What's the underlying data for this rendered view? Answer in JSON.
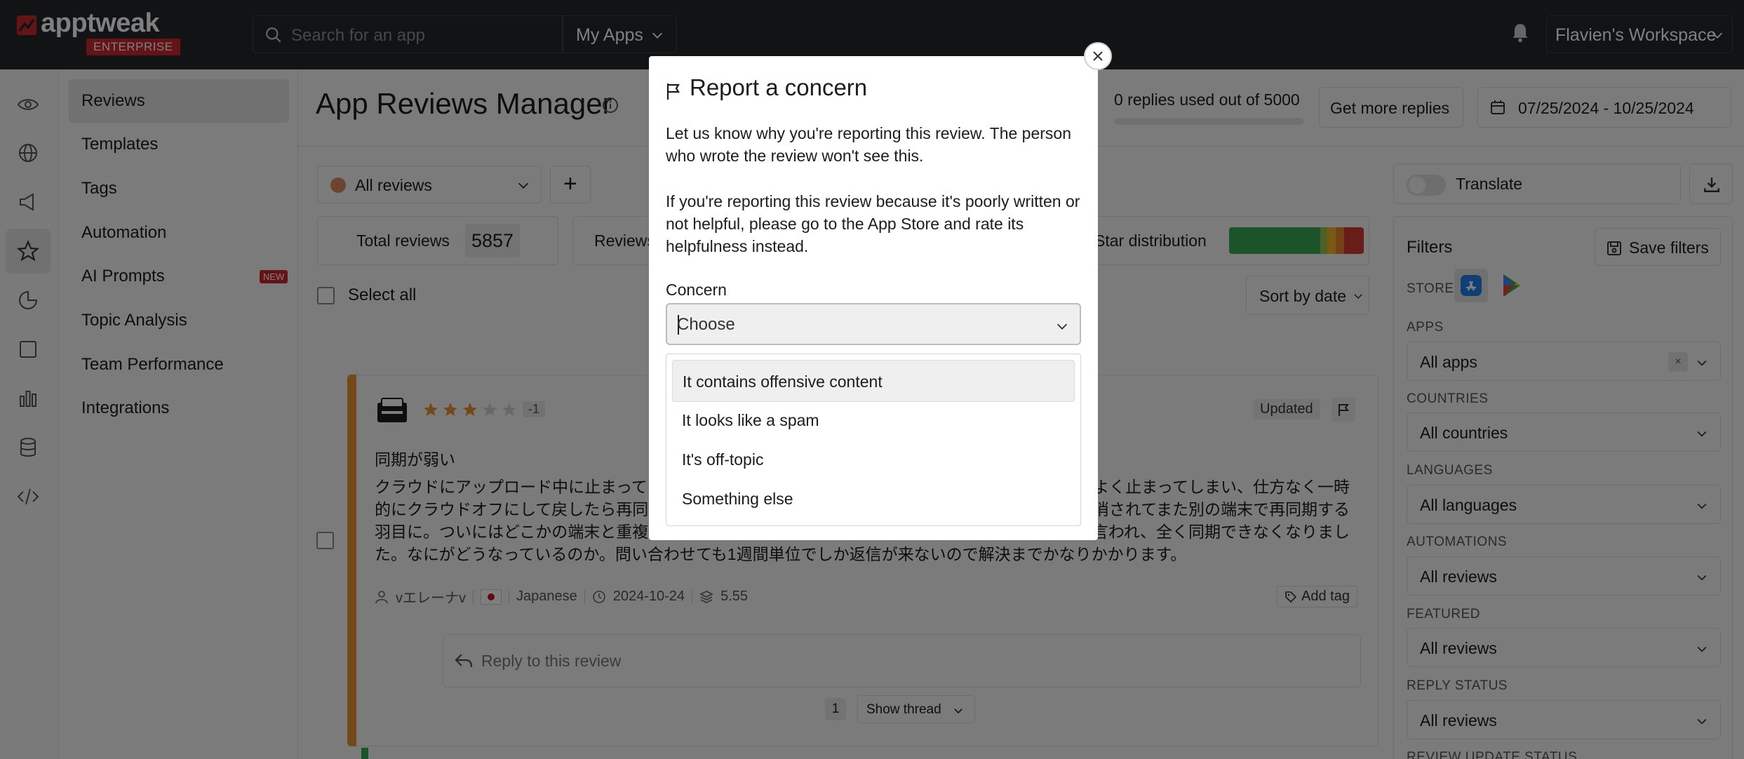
{
  "brand": {
    "name": "apptweak",
    "badge": "ENTERPRISE"
  },
  "topbar": {
    "search_placeholder": "Search for an app",
    "my_apps": "My Apps",
    "workspace": "Flavien's Workspace"
  },
  "sidebar": {
    "items": [
      {
        "label": "Reviews"
      },
      {
        "label": "Templates"
      },
      {
        "label": "Tags"
      },
      {
        "label": "Automation"
      },
      {
        "label": "AI Prompts",
        "badge": "NEW"
      },
      {
        "label": "Topic Analysis"
      },
      {
        "label": "Team Performance"
      },
      {
        "label": "Integrations"
      }
    ]
  },
  "header": {
    "title": "App Reviews Manager",
    "replies_used": "0 replies used out of 5000",
    "replies_fraction": 0,
    "get_more": "Get more replies",
    "date_range": "07/25/2024 - 10/25/2024"
  },
  "toolbar": {
    "view": "All reviews",
    "add": "+",
    "translate": "Translate"
  },
  "stats": {
    "total_label": "Total reviews",
    "total_value": "5857",
    "reviews_label": "Reviews",
    "star_label": "Star distribution"
  },
  "list": {
    "select_all": "Select all",
    "sort": "Sort by date"
  },
  "review": {
    "rating": 3,
    "delta": "-1",
    "status": "Updated",
    "title": "同期が弱い",
    "body_left": "クラウドにアップロード中に止まってし",
    "body_right_1": "よく止まってしまい、仕方なく一時",
    "body_line2_left": "的にクラウドオフにして戻したら再同期",
    "body_line2_right": "消されてまた別の端末で再同期する",
    "body_line3_left": "羽目に。ついにはどこかの端末と重複し",
    "body_line3_right": "言われ、全く同期できなくなりまし",
    "body_line4": "た。なにがどうなっているのか。問い合わせても1週間単位でしか返信が来ないので解決までかなりかかります。",
    "author": "vエレーナv",
    "language": "Japanese",
    "date": "2024-10-24",
    "version": "5.55",
    "add_tag": "Add tag",
    "reply_placeholder": "Reply to this review",
    "thread_count": "1",
    "show_thread": "Show thread"
  },
  "filters": {
    "title": "Filters",
    "save": "Save filters",
    "store_label": "STORE",
    "apps_label": "APPS",
    "apps_value": "All apps",
    "clear": "×",
    "countries_label": "COUNTRIES",
    "countries_value": "All countries",
    "languages_label": "LANGUAGES",
    "languages_value": "All languages",
    "automations_label": "AUTOMATIONS",
    "automations_value": "All reviews",
    "featured_label": "FEATURED",
    "featured_value": "All reviews",
    "reply_status_label": "REPLY STATUS",
    "reply_status_value": "All reviews",
    "review_update_label": "REVIEW UPDATE STATUS"
  },
  "modal": {
    "title": "Report a concern",
    "p1": "Let us know why you're reporting this review. The person who wrote the review won't see this.",
    "p2": "If you're reporting this review because it's poorly written or not helpful, please go to the App Store and rate its helpfulness instead.",
    "concern_label": "Concern",
    "concern_value": "Choose",
    "options": [
      "It contains offensive content",
      "It looks like a spam",
      "It's off-topic",
      "Something else"
    ]
  },
  "colors": {
    "accent_orange": "#e8932e",
    "brand_red": "#c8292c",
    "topbar": "#23262a"
  }
}
